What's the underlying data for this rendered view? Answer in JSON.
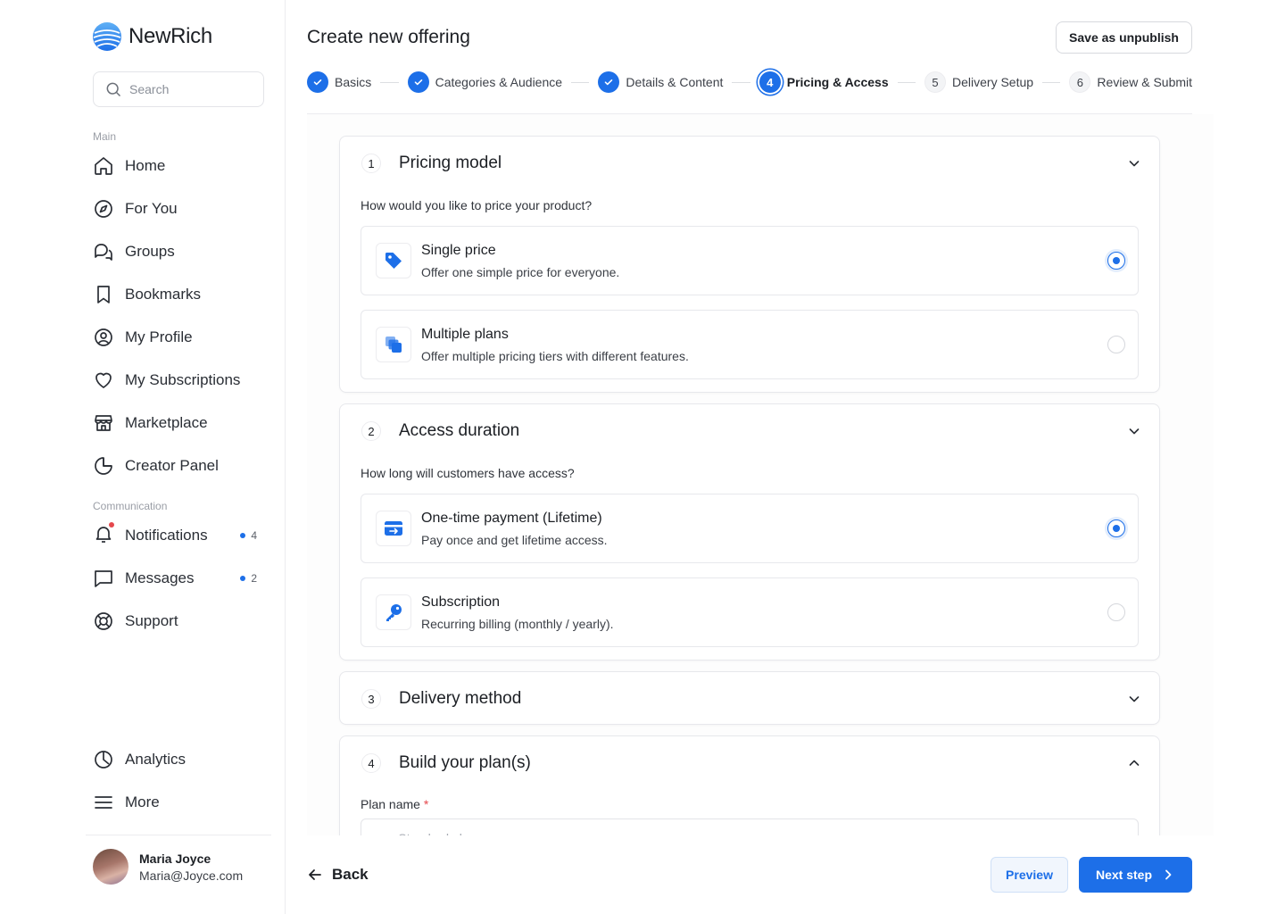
{
  "brand": {
    "name": "NewRich",
    "accent": "#1d6fe8"
  },
  "search": {
    "placeholder": "Search"
  },
  "sidebar": {
    "main_label": "Main",
    "main_items": [
      {
        "label": "Home",
        "icon": "home-icon"
      },
      {
        "label": "For You",
        "icon": "compass-icon"
      },
      {
        "label": "Groups",
        "icon": "chat-bubbles-icon"
      },
      {
        "label": "Bookmarks",
        "icon": "bookmark-icon"
      },
      {
        "label": "My Profile",
        "icon": "user-circle-icon"
      },
      {
        "label": "My Subscriptions",
        "icon": "heart-icon"
      },
      {
        "label": "Marketplace",
        "icon": "storefront-icon"
      },
      {
        "label": "Creator Panel",
        "icon": "pie-chart-icon"
      }
    ],
    "communication_label": "Communication",
    "communication_items": [
      {
        "label": "Notifications",
        "icon": "bell-icon",
        "badge": "4"
      },
      {
        "label": "Messages",
        "icon": "message-icon",
        "badge": "2"
      },
      {
        "label": "Support",
        "icon": "lifebuoy-icon"
      }
    ],
    "bottom_items": [
      {
        "label": "Analytics",
        "icon": "analytics-icon"
      },
      {
        "label": "More",
        "icon": "menu-icon"
      }
    ],
    "user": {
      "name": "Maria Joyce",
      "email": "Maria@Joyce.com"
    }
  },
  "header": {
    "title": "Create new offering",
    "save_label": "Save as unpublish",
    "steps": [
      {
        "label": "Basics",
        "state": "done"
      },
      {
        "label": "Categories & Audience",
        "state": "done"
      },
      {
        "label": "Details & Content",
        "state": "done"
      },
      {
        "number": "4",
        "label": "Pricing & Access",
        "state": "active"
      },
      {
        "number": "5",
        "label": "Delivery Setup",
        "state": "todo"
      },
      {
        "number": "6",
        "label": "Review & Submit",
        "state": "todo"
      }
    ]
  },
  "sections": {
    "pricing": {
      "number": "1",
      "title": "Pricing model",
      "question": "How would you like to price your product?",
      "options": [
        {
          "title": "Single price",
          "desc": "Offer one simple price for everyone.",
          "icon": "price-tag-icon",
          "selected": true
        },
        {
          "title": "Multiple plans",
          "desc": "Offer multiple pricing tiers with different features.",
          "icon": "stacked-cards-icon",
          "selected": false
        }
      ]
    },
    "access": {
      "number": "2",
      "title": "Access duration",
      "question": "How long will customers have access?",
      "options": [
        {
          "title": "One-time payment (Lifetime)",
          "desc": "Pay once and get lifetime access.",
          "icon": "card-transfer-icon",
          "selected": true
        },
        {
          "title": "Subscription",
          "desc": "Recurring billing (monthly / yearly).",
          "icon": "key-icon",
          "selected": false
        }
      ]
    },
    "delivery": {
      "number": "3",
      "title": "Delivery method"
    },
    "plans": {
      "number": "4",
      "title": "Build your plan(s)",
      "plan_name_label": "Plan name",
      "required_mark": "*",
      "plan_name_placeholder": "e.g. Standard plan"
    }
  },
  "footer": {
    "back_label": "Back",
    "preview_label": "Preview",
    "next_label": "Next step"
  }
}
